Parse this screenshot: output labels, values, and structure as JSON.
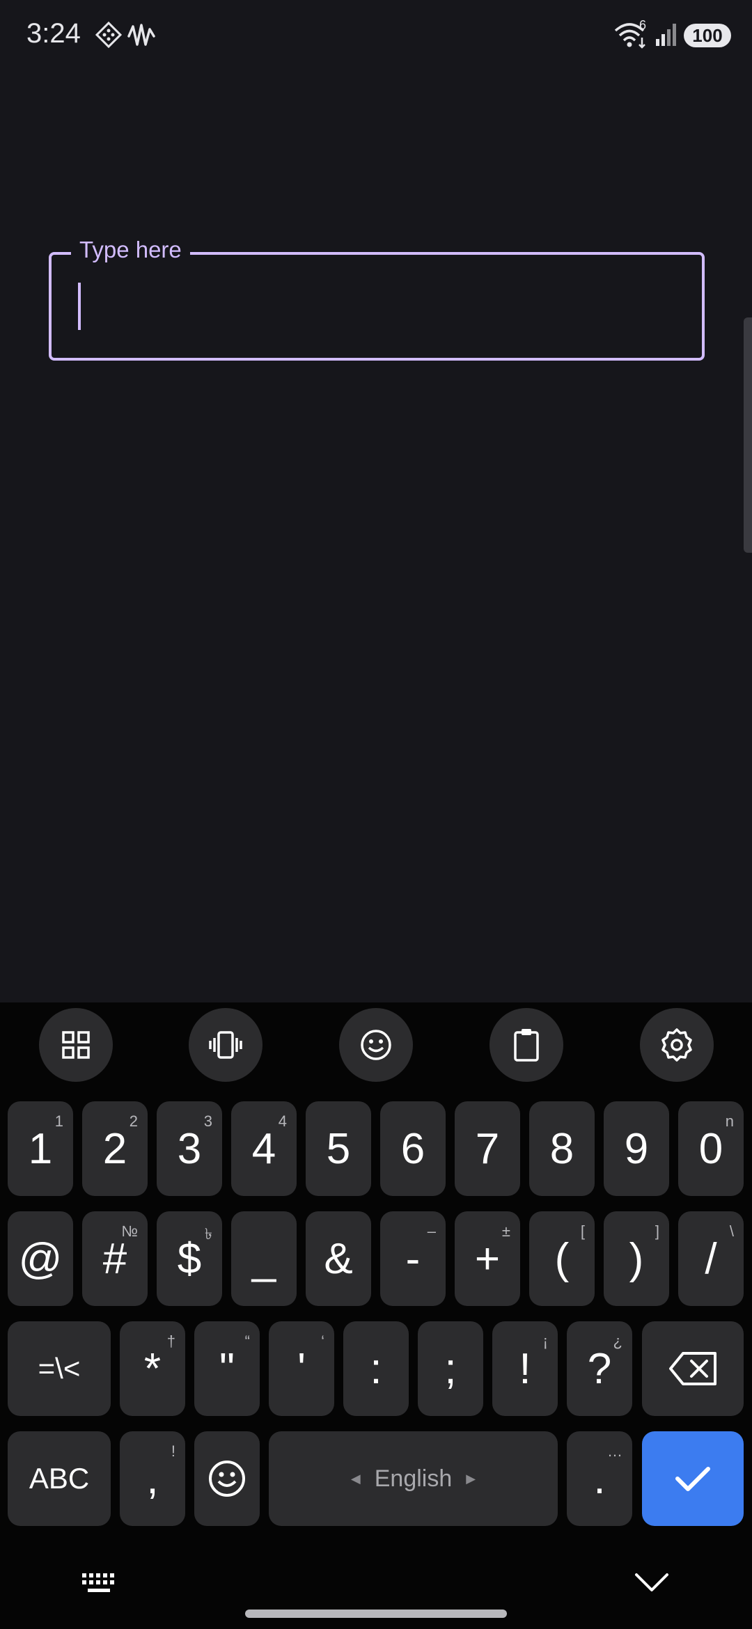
{
  "status": {
    "time": "3:24",
    "network_badge": "6",
    "battery": "100",
    "icons": [
      "accessibility-icon",
      "sound-wave-icon",
      "wifi-icon",
      "signal-icon"
    ]
  },
  "field": {
    "label": "Type here",
    "value": ""
  },
  "toolbar": {
    "items": [
      "grid-icon",
      "vibrate-icon",
      "emoji-icon",
      "clipboard-icon",
      "settings-icon"
    ]
  },
  "keyboard": {
    "row1": [
      {
        "main": "1",
        "sub": "1"
      },
      {
        "main": "2",
        "sub": "2"
      },
      {
        "main": "3",
        "sub": "3"
      },
      {
        "main": "4",
        "sub": "4"
      },
      {
        "main": "5",
        "sub": ""
      },
      {
        "main": "6",
        "sub": ""
      },
      {
        "main": "7",
        "sub": ""
      },
      {
        "main": "8",
        "sub": ""
      },
      {
        "main": "9",
        "sub": ""
      },
      {
        "main": "0",
        "sub": "n"
      }
    ],
    "row2": [
      {
        "main": "@",
        "sub": ""
      },
      {
        "main": "#",
        "sub": "№"
      },
      {
        "main": "$",
        "sub": "৳"
      },
      {
        "main": "_",
        "sub": ""
      },
      {
        "main": "&",
        "sub": ""
      },
      {
        "main": "-",
        "sub": "–"
      },
      {
        "main": "+",
        "sub": "±"
      },
      {
        "main": "(",
        "sub": "["
      },
      {
        "main": ")",
        "sub": "]"
      },
      {
        "main": "/",
        "sub": "\\"
      }
    ],
    "row3": [
      {
        "main": "=\\<",
        "sub": ""
      },
      {
        "main": "*",
        "sub": "†"
      },
      {
        "main": "\"",
        "sub": "“"
      },
      {
        "main": "'",
        "sub": "‘"
      },
      {
        "main": ":",
        "sub": ""
      },
      {
        "main": ";",
        "sub": ""
      },
      {
        "main": "!",
        "sub": "¡"
      },
      {
        "main": "?",
        "sub": "¿"
      }
    ],
    "abc": "ABC",
    "comma": {
      "main": ",",
      "sub": "!"
    },
    "language": "English",
    "period": {
      "main": ".",
      "sub": "…"
    }
  },
  "colors": {
    "accent": "#d2bcff",
    "key": "#2c2c2e",
    "enter": "#3c7cf0",
    "background": "#16161b"
  }
}
